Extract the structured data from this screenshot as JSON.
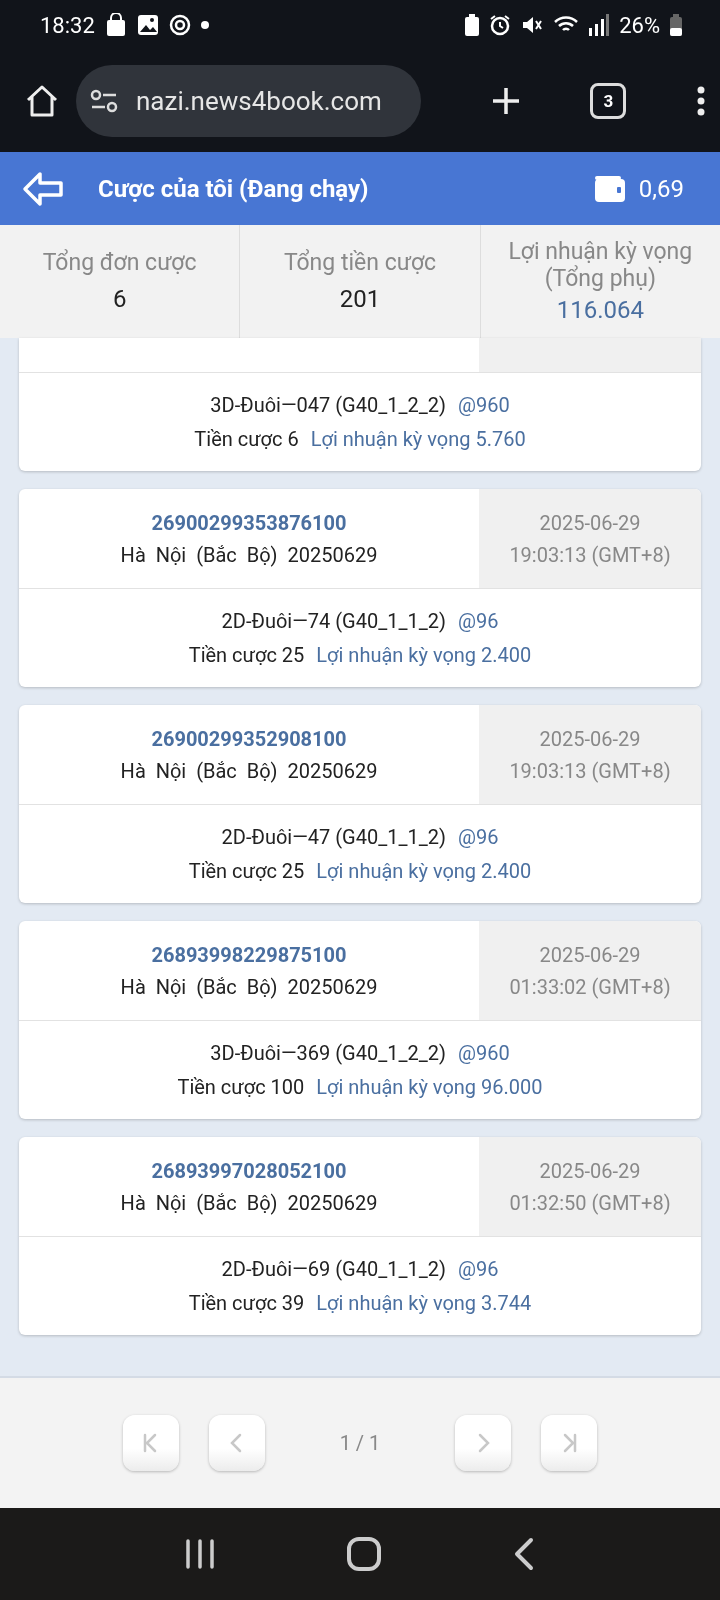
{
  "status_bar": {
    "time": "18:32",
    "battery": "26%"
  },
  "browser": {
    "url": "nazi.news4book.com",
    "tab_count": "3"
  },
  "header": {
    "title": "Cược của tôi (Đang chạy)",
    "balance": "0,69"
  },
  "summary": [
    {
      "label": "Tổng đơn cược",
      "value": "6",
      "highlight": false
    },
    {
      "label": "Tổng tiền cược",
      "value": "201",
      "highlight": false
    },
    {
      "label": "Lợi nhuận kỳ vọng (Tổng phụ)",
      "value": "116.064",
      "highlight": true
    }
  ],
  "bets": [
    {
      "partial": true,
      "selection": "3D-Đuôi—047 (G40_1_2_2)",
      "odds": "@960",
      "stake": "Tiền cược 6",
      "expected": "Lợi nhuận kỳ vọng 5.760"
    },
    {
      "partial": false,
      "id": "26900299353876100",
      "market": "Hà  Nội  (Bắc  Bộ)  20250629",
      "date": "2025-06-29",
      "time": "19:03:13 (GMT+8)",
      "selection": "2D-Đuôi—74 (G40_1_1_2)",
      "odds": "@96",
      "stake": "Tiền cược 25",
      "expected": "Lợi nhuận kỳ vọng 2.400"
    },
    {
      "partial": false,
      "id": "26900299352908100",
      "market": "Hà  Nội  (Bắc  Bộ)  20250629",
      "date": "2025-06-29",
      "time": "19:03:13 (GMT+8)",
      "selection": "2D-Đuôi—47 (G40_1_1_2)",
      "odds": "@96",
      "stake": "Tiền cược 25",
      "expected": "Lợi nhuận kỳ vọng 2.400"
    },
    {
      "partial": false,
      "id": "26893998229875100",
      "market": "Hà  Nội  (Bắc  Bộ)  20250629",
      "date": "2025-06-29",
      "time": "01:33:02 (GMT+8)",
      "selection": "3D-Đuôi—369 (G40_1_2_2)",
      "odds": "@960",
      "stake": "Tiền cược 100",
      "expected": "Lợi nhuận kỳ vọng 96.000"
    },
    {
      "partial": false,
      "id": "26893997028052100",
      "market": "Hà  Nội  (Bắc  Bộ)  20250629",
      "date": "2025-06-29",
      "time": "01:32:50 (GMT+8)",
      "selection": "2D-Đuôi—69 (G40_1_1_2)",
      "odds": "@96",
      "stake": "Tiền cược 39",
      "expected": "Lợi nhuận kỳ vọng 3.744"
    }
  ],
  "pagination": {
    "page": "1 / 1",
    "buttons": [
      {
        "kind": "first",
        "disabled": true
      },
      {
        "kind": "prev",
        "disabled": true
      },
      {
        "kind": "next",
        "disabled": true
      },
      {
        "kind": "last",
        "disabled": true
      }
    ]
  }
}
